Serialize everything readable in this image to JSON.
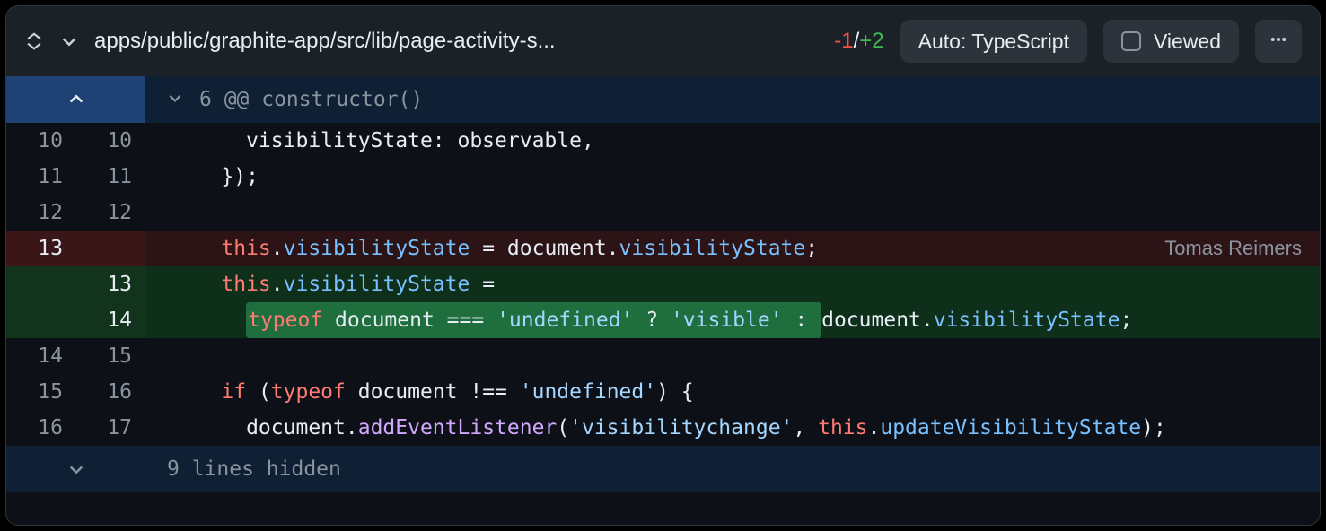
{
  "header": {
    "file_path": "apps/public/graphite-app/src/lib/page-activity-s...",
    "deletions": "-1",
    "slash": "/",
    "additions": "+2",
    "language_pill": "Auto: TypeScript",
    "viewed_label": "Viewed"
  },
  "hunk": {
    "summary": "6 @@ constructor()"
  },
  "lines": [
    {
      "type": "ctx",
      "old": "10",
      "new": "10",
      "tokens": [
        {
          "cls": "tok-pl",
          "t": "      visibilityState: observable,"
        }
      ]
    },
    {
      "type": "ctx",
      "old": "11",
      "new": "11",
      "tokens": [
        {
          "cls": "tok-pl",
          "t": "    });"
        }
      ]
    },
    {
      "type": "ctx",
      "old": "12",
      "new": "12",
      "tokens": [
        {
          "cls": "tok-pl",
          "t": ""
        }
      ]
    },
    {
      "type": "del",
      "old": "13",
      "new": "",
      "blame": "Tomas Reimers",
      "tokens": [
        {
          "cls": "tok-pl",
          "t": "    "
        },
        {
          "cls": "tok-kw",
          "t": "this"
        },
        {
          "cls": "tok-pl",
          "t": "."
        },
        {
          "cls": "tok-prop",
          "t": "visibilityState"
        },
        {
          "cls": "tok-pl",
          "t": " = document."
        },
        {
          "cls": "tok-prop",
          "t": "visibilityState"
        },
        {
          "cls": "tok-pl",
          "t": ";"
        }
      ]
    },
    {
      "type": "add",
      "old": "",
      "new": "13",
      "tokens": [
        {
          "cls": "tok-pl",
          "t": "    "
        },
        {
          "cls": "tok-kw",
          "t": "this"
        },
        {
          "cls": "tok-pl",
          "t": "."
        },
        {
          "cls": "tok-prop",
          "t": "visibilityState"
        },
        {
          "cls": "tok-pl",
          "t": " ="
        }
      ]
    },
    {
      "type": "add",
      "old": "",
      "new": "14",
      "highlight_prefix": true,
      "tokens": [
        {
          "cls": "tok-pl",
          "t": "      "
        },
        {
          "cls": "tok-kw",
          "t": "typeof",
          "hl": true
        },
        {
          "cls": "tok-pl",
          "t": " document === ",
          "hl": true
        },
        {
          "cls": "tok-str",
          "t": "'undefined'",
          "hl": true
        },
        {
          "cls": "tok-pl",
          "t": " ? ",
          "hl": true
        },
        {
          "cls": "tok-str",
          "t": "'visible'",
          "hl": true
        },
        {
          "cls": "tok-pl",
          "t": " : ",
          "hl": true
        },
        {
          "cls": "tok-pl",
          "t": "document."
        },
        {
          "cls": "tok-prop",
          "t": "visibilityState"
        },
        {
          "cls": "tok-pl",
          "t": ";"
        }
      ]
    },
    {
      "type": "ctx",
      "old": "14",
      "new": "15",
      "tokens": [
        {
          "cls": "tok-pl",
          "t": ""
        }
      ]
    },
    {
      "type": "ctx",
      "old": "15",
      "new": "16",
      "tokens": [
        {
          "cls": "tok-pl",
          "t": "    "
        },
        {
          "cls": "tok-kw",
          "t": "if"
        },
        {
          "cls": "tok-pl",
          "t": " ("
        },
        {
          "cls": "tok-kw",
          "t": "typeof"
        },
        {
          "cls": "tok-pl",
          "t": " document !== "
        },
        {
          "cls": "tok-str",
          "t": "'undefined'"
        },
        {
          "cls": "tok-pl",
          "t": ") {"
        }
      ]
    },
    {
      "type": "ctx",
      "old": "16",
      "new": "17",
      "tokens": [
        {
          "cls": "tok-pl",
          "t": "      document."
        },
        {
          "cls": "tok-fn",
          "t": "addEventListener"
        },
        {
          "cls": "tok-pl",
          "t": "("
        },
        {
          "cls": "tok-str",
          "t": "'visibilitychange'"
        },
        {
          "cls": "tok-pl",
          "t": ", "
        },
        {
          "cls": "tok-kw",
          "t": "this"
        },
        {
          "cls": "tok-pl",
          "t": "."
        },
        {
          "cls": "tok-prop",
          "t": "updateVisibilityState"
        },
        {
          "cls": "tok-pl",
          "t": ");"
        }
      ]
    }
  ],
  "footer": {
    "hidden_text": "9 lines hidden"
  }
}
